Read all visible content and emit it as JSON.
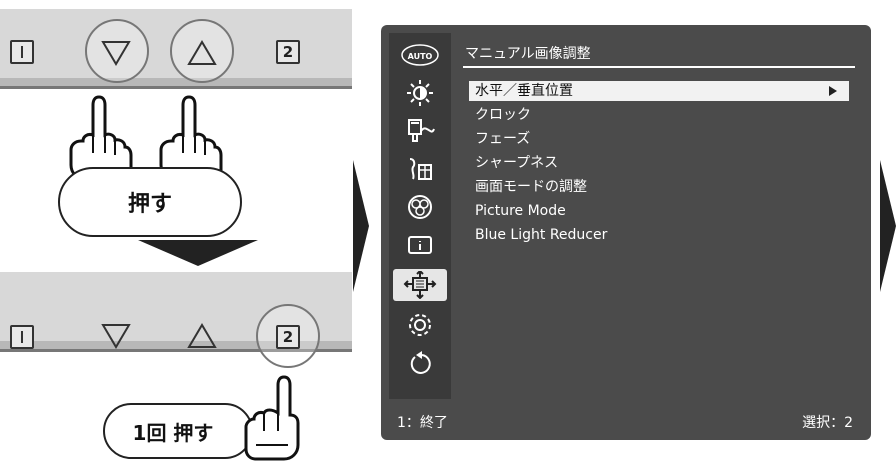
{
  "top_panel": {
    "button_1": "",
    "button_2": "2"
  },
  "press_label": "押す",
  "bottom_panel": {
    "button_1": "",
    "button_2": "2"
  },
  "press_once_label": "1回 押す",
  "osd": {
    "title": "マニュアル画像調整",
    "sidebar_icons": [
      {
        "name": "auto-icon",
        "text": "AUTO"
      },
      {
        "name": "brightness-icon"
      },
      {
        "name": "input-icon"
      },
      {
        "name": "audio-icon"
      },
      {
        "name": "color-icon"
      },
      {
        "name": "info-icon"
      },
      {
        "name": "image-adjust-icon",
        "selected": true
      },
      {
        "name": "settings-icon"
      },
      {
        "name": "reset-icon"
      }
    ],
    "menu_items": [
      {
        "label": "水平／垂直位置",
        "selected": true
      },
      {
        "label": "クロック"
      },
      {
        "label": "フェーズ"
      },
      {
        "label": "シャープネス"
      },
      {
        "label": "画面モードの調整"
      },
      {
        "label": "Picture Mode"
      },
      {
        "label": "Blue Light Reducer"
      }
    ],
    "status_left": "1：終了",
    "status_right": "選択：2"
  },
  "colors": {
    "osd_bg": "#4b4b4b",
    "sidebar_bg": "#3a3a3a",
    "panel_bg": "#d8d8d8"
  }
}
